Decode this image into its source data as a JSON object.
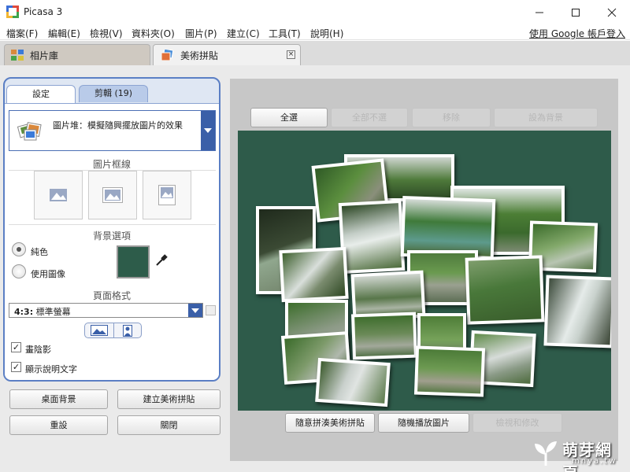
{
  "window": {
    "title": "Picasa 3"
  },
  "menu": {
    "items": [
      "檔案(F)",
      "編輯(E)",
      "檢視(V)",
      "資料夾(O)",
      "圖片(P)",
      "建立(C)",
      "工具(T)",
      "說明(H)"
    ],
    "signin": "使用 Google 帳戶登入"
  },
  "tabs": {
    "library": "相片庫",
    "collage": "美術拼貼"
  },
  "panel": {
    "tab_settings": "設定",
    "tab_clips": "剪輯 (19)",
    "style_label": "圖片堆：模擬隨興擺放圖片的效果",
    "frame_title": "圖片框線",
    "background_title": "背景選項",
    "bg_solid": "純色",
    "bg_image": "使用圖像",
    "bg_color": "#2d5c4a",
    "format_title": "頁面格式",
    "format_value_bold": "4:3:",
    "format_value": "標準螢幕",
    "drop_shadow": "畫陰影",
    "show_captions": "顯示說明文字"
  },
  "actions": {
    "desktop": "桌面背景",
    "create": "建立美術拼貼",
    "reset": "重設",
    "close": "關閉"
  },
  "tray": {
    "select_all": "全選",
    "deselect_all": "全部不選",
    "remove": "移除",
    "set_background": "設為背景",
    "shuffle": "隨意拼湊美術拼貼",
    "random_play": "隨機播放圖片",
    "review": "檢視和修改"
  },
  "watermark": {
    "text": "萌芽網頁",
    "url": "mnya.tw"
  }
}
